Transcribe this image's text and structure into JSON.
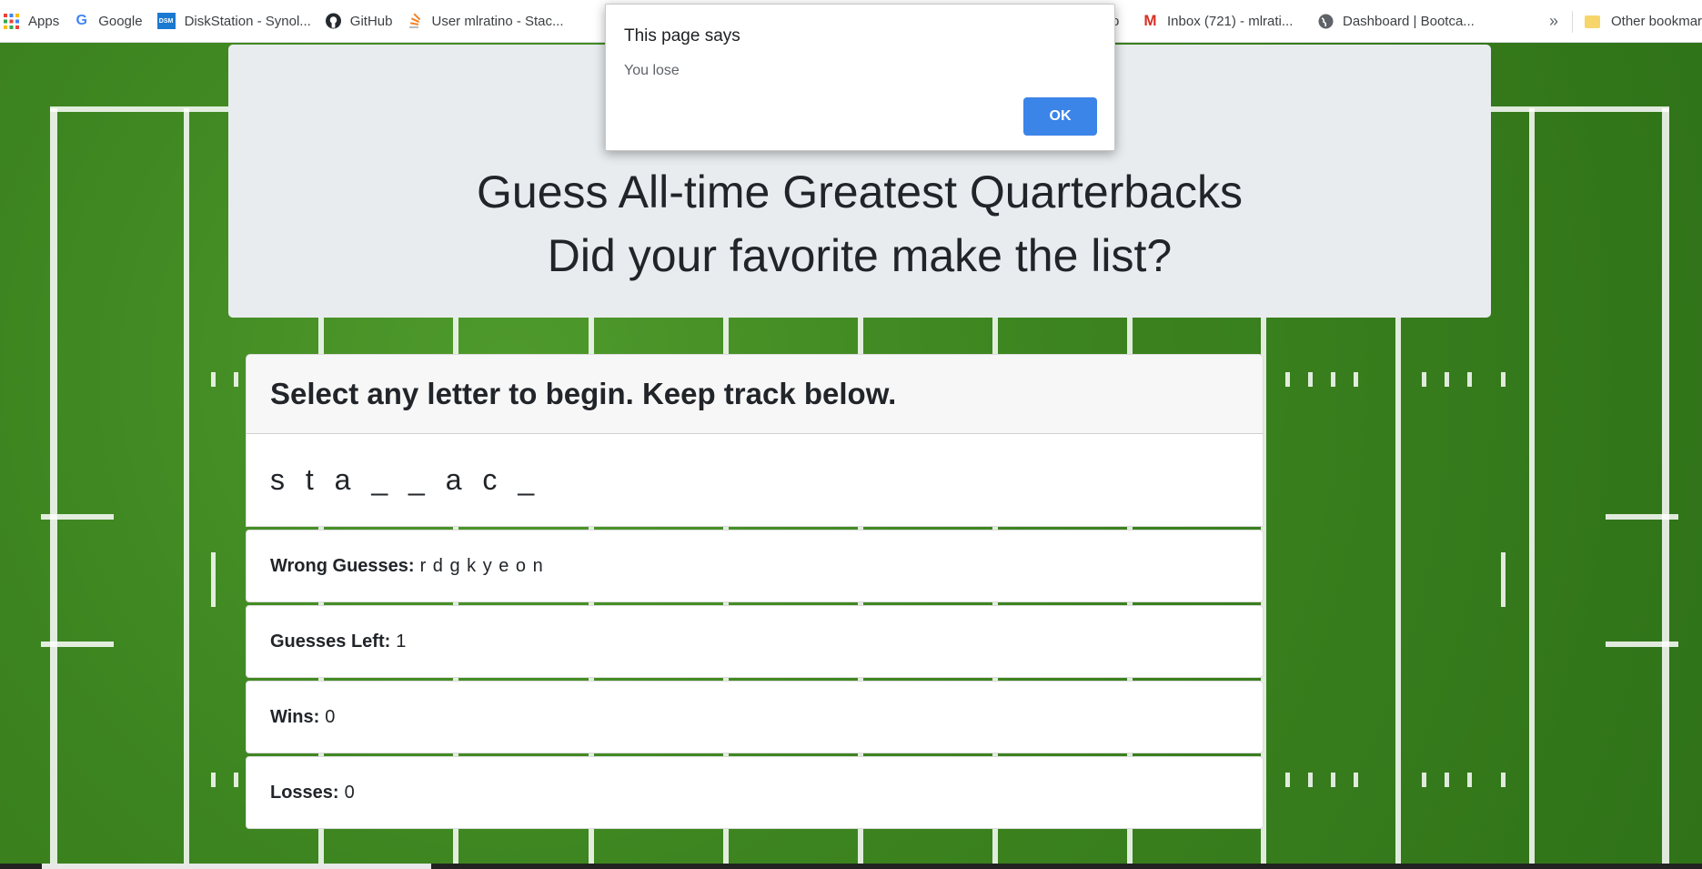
{
  "bookmarks": {
    "items": [
      {
        "label": "Apps",
        "icon": "apps-grid-icon"
      },
      {
        "label": "Google",
        "icon": "google-icon"
      },
      {
        "label": "DiskStation - Synol...",
        "icon": "dsm-icon"
      },
      {
        "label": "GitHub",
        "icon": "github-icon"
      },
      {
        "label": "User mlratino - Stac...",
        "icon": "stackoverflow-icon"
      },
      {
        "label": "o",
        "icon": ""
      },
      {
        "label": "Inbox (721) - mlrati...",
        "icon": "gmail-icon"
      },
      {
        "label": "Dashboard | Bootca...",
        "icon": "globe-icon"
      }
    ],
    "overflow": "»",
    "other": "Other bookmar"
  },
  "dialog": {
    "title": "This page says",
    "message": "You lose",
    "ok_label": "OK"
  },
  "jumbotron": {
    "line1": "Guess All-time Greatest Quarterbacks",
    "line2": "Did your favorite make the list?"
  },
  "game": {
    "header": "Select any letter to begin. Keep track below.",
    "word": "s t a _ _ a c _",
    "wrong_label": "Wrong Guesses:",
    "wrong_value": "r d g k y e o n",
    "left_label": "Guesses Left:",
    "left_value": "1",
    "wins_label": "Wins:",
    "wins_value": "0",
    "losses_label": "Losses:",
    "losses_value": "0"
  },
  "colors": {
    "ok_button": "#3b84e8",
    "field_green": "#3d8520"
  }
}
